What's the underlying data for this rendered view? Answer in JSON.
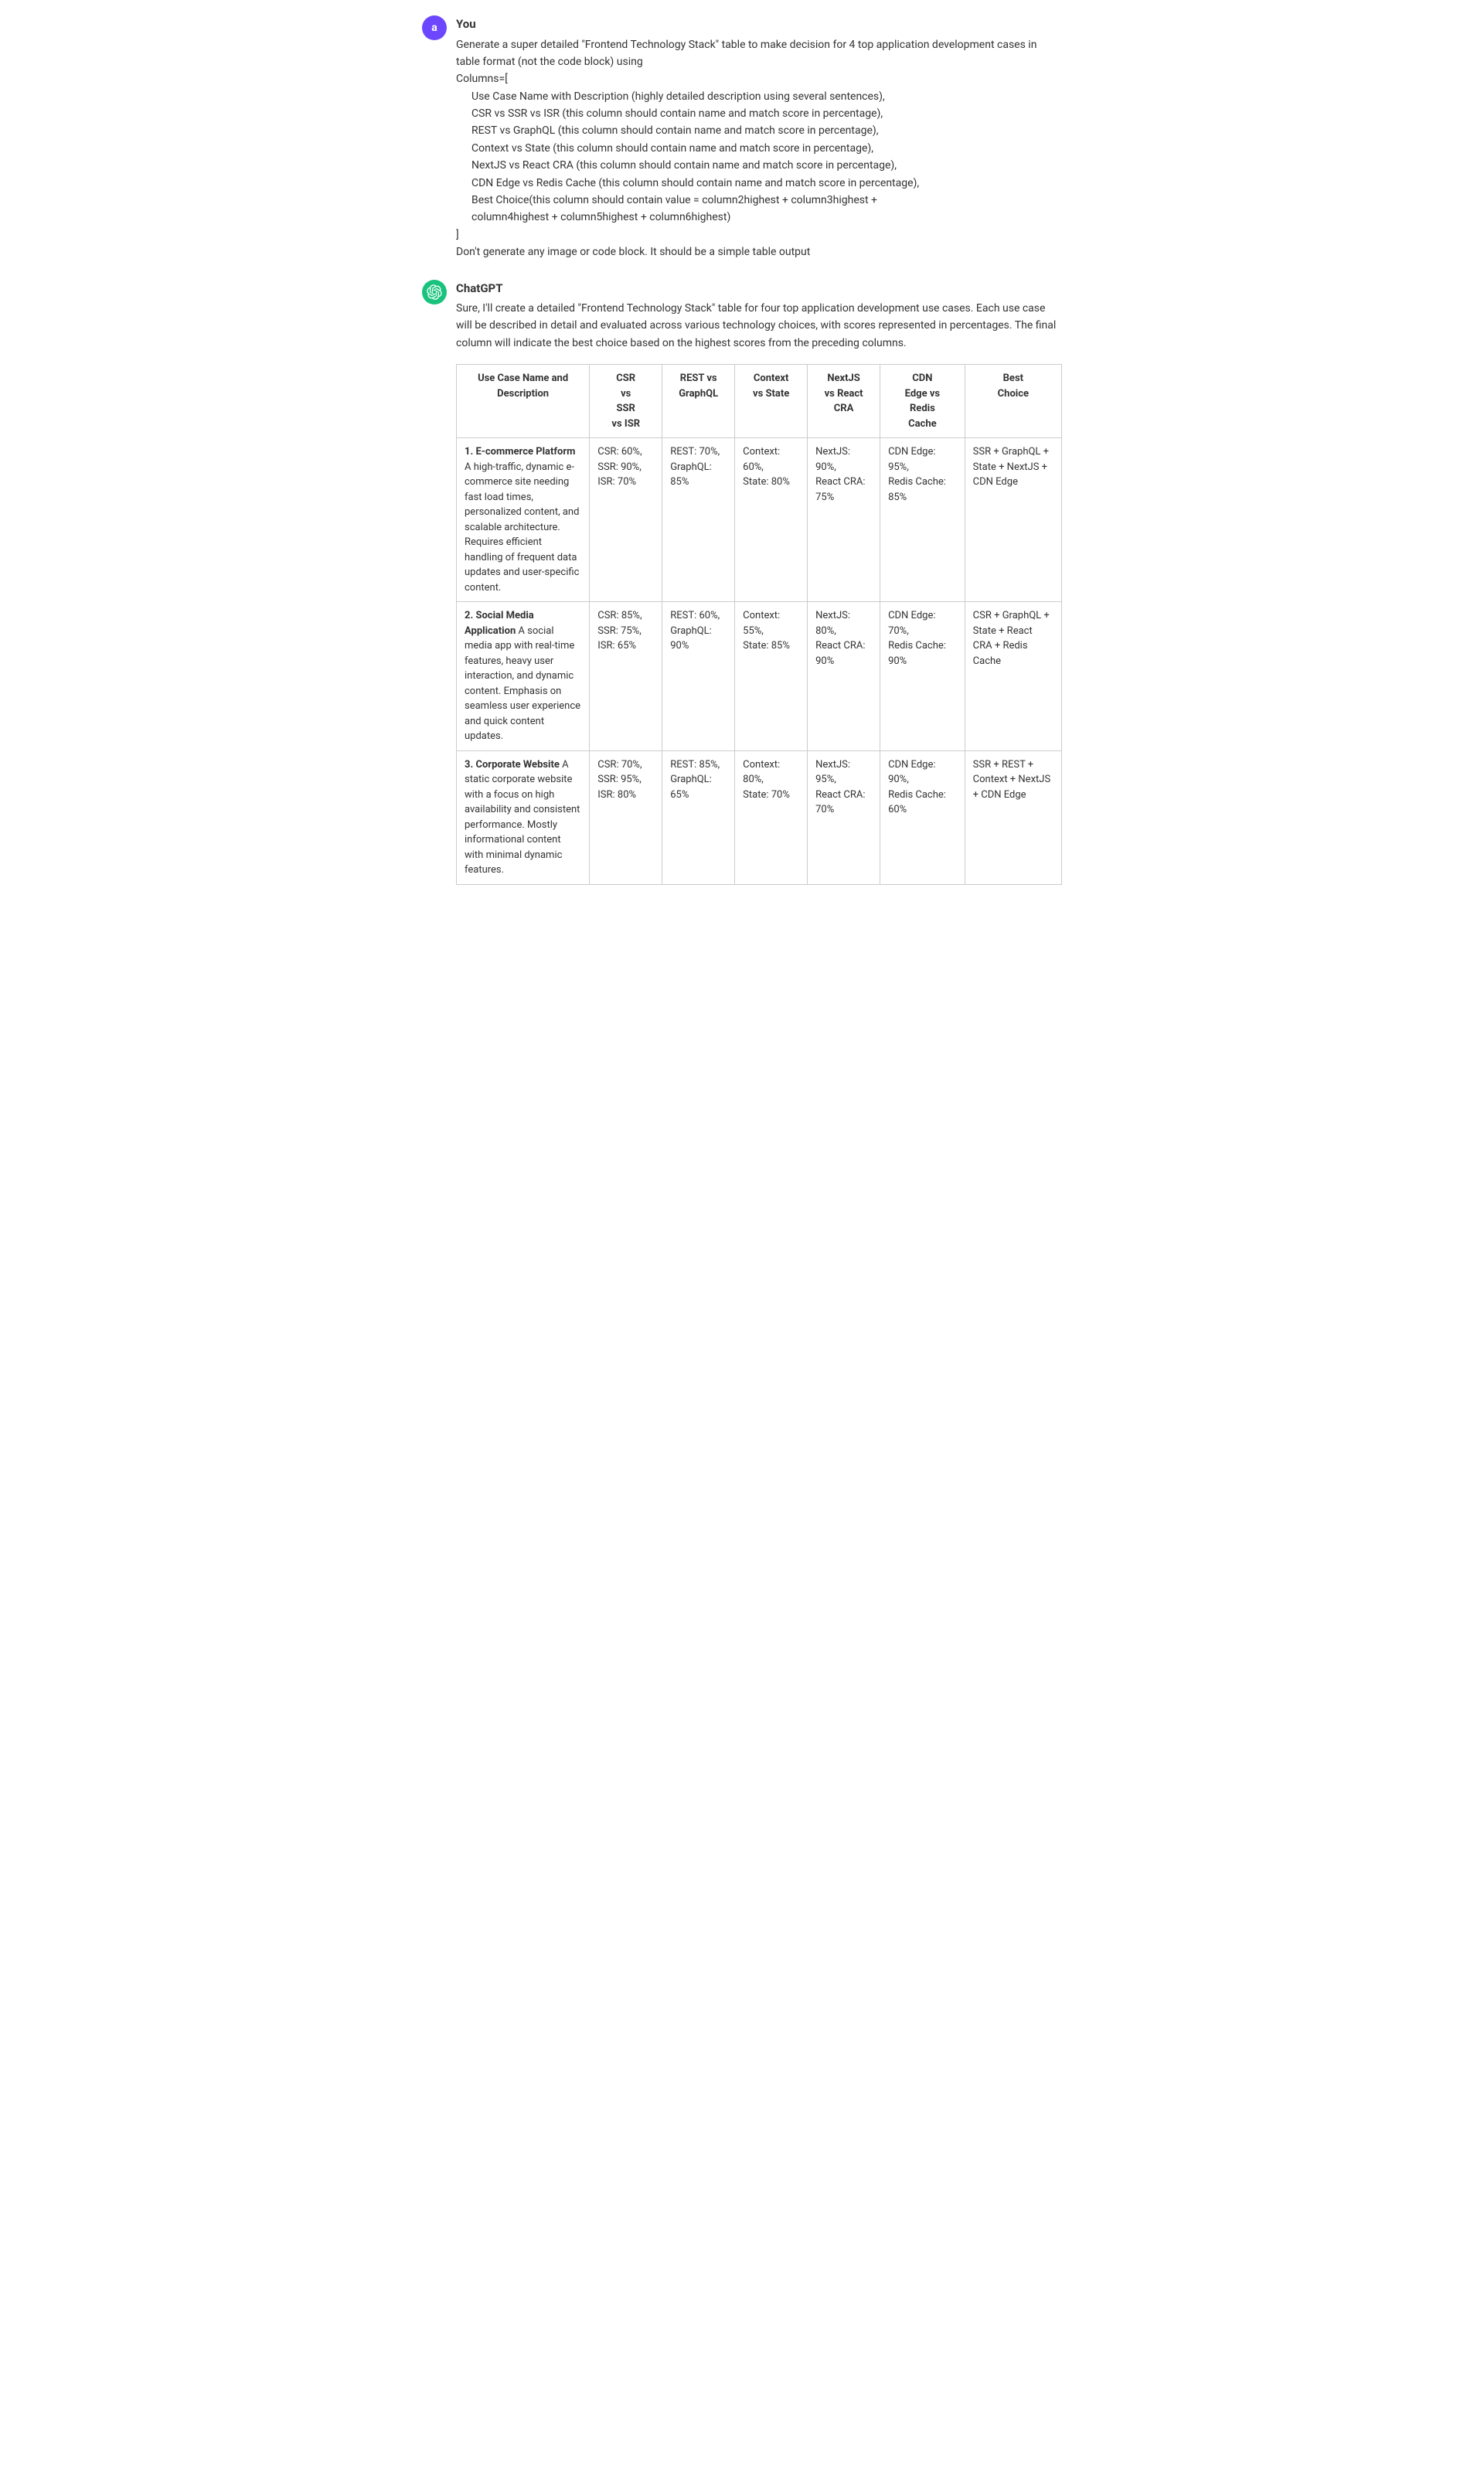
{
  "user": {
    "avatar_letter": "a",
    "name": "You",
    "message_lines": [
      "Generate a super detailed \"Frontend Technology Stack\" table to make decision for 4 top application development cases in table format (not the code block) using",
      "Columns=[",
      "  Use Case Name with Description (highly detailed description using several sentences),",
      "  CSR vs SSR vs ISR (this column should contain name and match score in percentage),",
      "  REST vs GraphQL (this column should contain name and match score in percentage),",
      "  Context vs State (this column should contain name and match score in percentage),",
      "  NextJS vs React CRA (this column should contain name and match score in percentage),",
      "  CDN Edge vs Redis Cache (this column should contain name and match score in percentage),",
      "  Best Choice(this column should contain value = column2highest + column3highest +",
      "  column4highest + column5highest + column6highest)",
      "]",
      "Don't generate any image or code block. It should be a simple table output"
    ]
  },
  "gpt": {
    "name": "ChatGPT",
    "intro": "Sure, I'll create a detailed \"Frontend Technology Stack\" table for four top application development use cases. Each use case will be described in detail and evaluated across various technology choices, with scores represented in percentages. The final column will indicate the best choice based on the highest scores from the preceding columns.",
    "table": {
      "headers": [
        "Use Case Name and Description",
        "CSR vs SSR vs ISR",
        "REST vs GraphQL",
        "Context vs State",
        "NextJS vs React CRA",
        "CDN Edge vs Redis Cache",
        "Best Choice"
      ],
      "rows": [
        {
          "usecase": "1. E-commerce Platform A high-traffic, dynamic e-commerce site needing fast load times, personalized content, and scalable architecture. Requires efficient handling of frequent data updates and user-specific content.",
          "usecase_bold": "1. E-commerce Platform",
          "usecase_rest": " A high-traffic, dynamic e-commerce site needing fast load times, personalized content, and scalable architecture. Requires efficient handling of frequent data updates and user-specific content.",
          "csr": "CSR: 60%, SSR: 90%, ISR: 70%",
          "rest": "REST: 70%, GraphQL: 85%",
          "context": "Context: 60%, State: 80%",
          "nextjs": "NextJS: 90%, React CRA: 75%",
          "cdn": "CDN Edge: 95%, Redis Cache: 85%",
          "best": "SSR + GraphQL + State + NextJS + CDN Edge"
        },
        {
          "usecase": "2. Social Media Application A social media app with real-time features, heavy user interaction, and dynamic content. Emphasis on seamless user experience and quick content updates.",
          "usecase_bold": "2. Social Media Application",
          "usecase_rest": " A social media app with real-time features, heavy user interaction, and dynamic content. Emphasis on seamless user experience and quick content updates.",
          "csr": "CSR: 85%, SSR: 75%, ISR: 65%",
          "rest": "REST: 60%, GraphQL: 90%",
          "context": "Context: 55%, State: 85%",
          "nextjs": "NextJS: 80%, React CRA: 90%",
          "cdn": "CDN Edge: 70%, Redis Cache: 90%",
          "best": "CSR + GraphQL + State + React CRA + Redis Cache"
        },
        {
          "usecase": "3. Corporate Website A static corporate website with a focus on high availability and consistent performance. Mostly informational content with minimal dynamic features.",
          "usecase_bold": "3. Corporate Website",
          "usecase_rest": " A static corporate website with a focus on high availability and consistent performance. Mostly informational content with minimal dynamic features.",
          "csr": "CSR: 70%, SSR: 95%, ISR: 80%",
          "rest": "REST: 85%, GraphQL: 65%",
          "context": "Context: 80%, State: 70%",
          "nextjs": "NextJS: 95%, React CRA: 70%",
          "cdn": "CDN Edge: 90%, Redis Cache: 60%",
          "best": "SSR + REST + Context + NextJS + CDN Edge"
        }
      ]
    }
  }
}
